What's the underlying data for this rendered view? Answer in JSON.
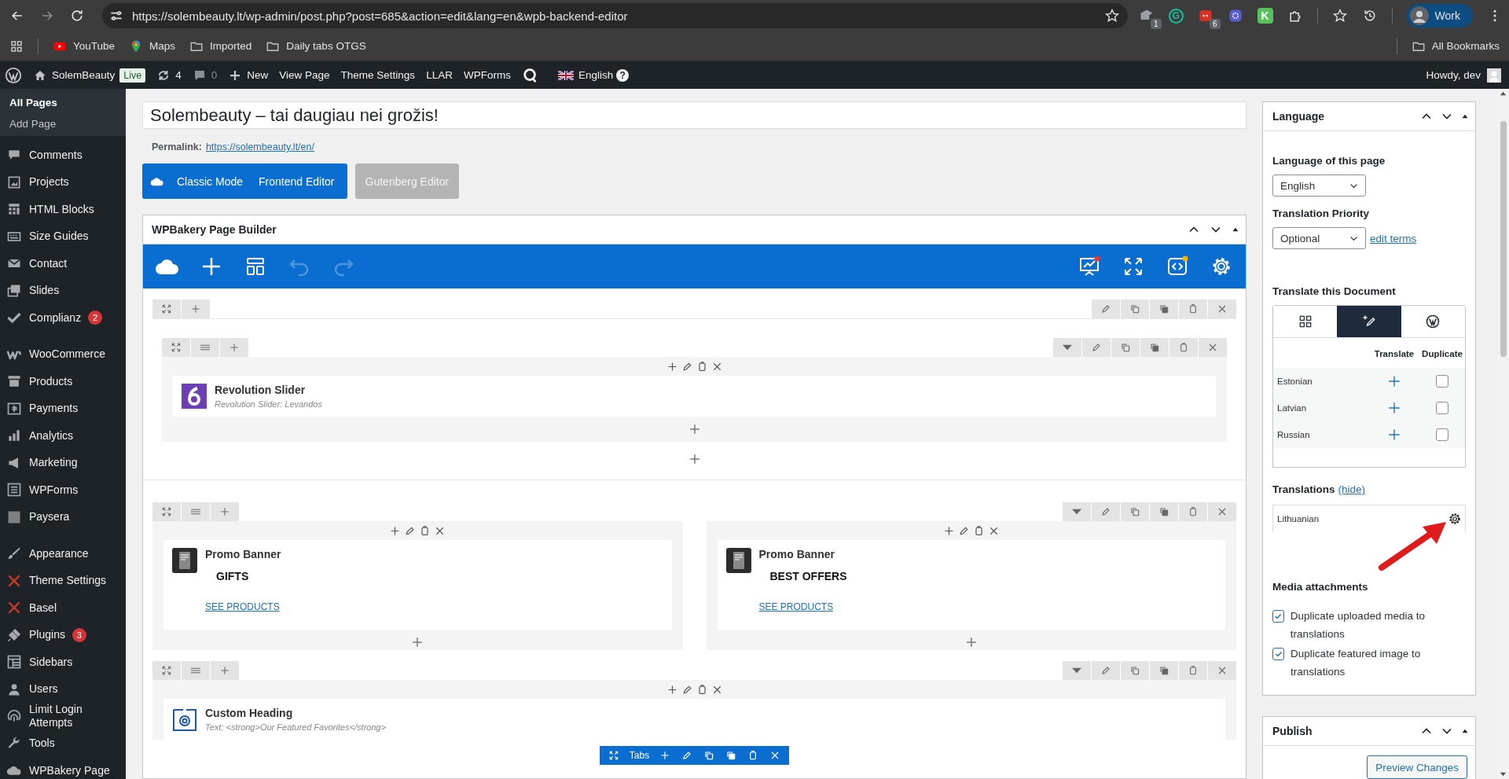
{
  "browser": {
    "url": "https://solembeauty.lt/wp-admin/post.php?post=685&action=edit&lang=en&wpb-backend-editor",
    "extensions": [
      {
        "kind": "grey",
        "badge": "1"
      },
      {
        "kind": "ring",
        "glyph": "G"
      },
      {
        "kind": "red",
        "badge": "6"
      },
      {
        "kind": "burst"
      },
      {
        "kind": "tile",
        "glyph": "K"
      }
    ],
    "profile": "Work",
    "bookmarks": [
      {
        "kind": "video",
        "label": "YouTube"
      },
      {
        "kind": "pin",
        "label": "Maps"
      },
      {
        "kind": "folder",
        "label": "Imported"
      },
      {
        "kind": "folder",
        "label": "Daily tabs OTGS"
      }
    ],
    "all_bookmarks": "All Bookmarks"
  },
  "admin_bar": {
    "site": "SolemBeauty",
    "live": "Live",
    "updates": "4",
    "comments": "0",
    "links": [
      "New",
      "View Page",
      "Theme Settings",
      "LLAR",
      "WPForms"
    ],
    "language": "English",
    "help": "?",
    "greeting": "Howdy, dev"
  },
  "sidebar": {
    "submenu": [
      {
        "label": "All Pages",
        "selected": true
      },
      {
        "label": "Add Page",
        "selected": false
      }
    ],
    "groups": [
      [
        {
          "label": "Comments"
        },
        {
          "label": "Projects"
        },
        {
          "label": "HTML Blocks"
        },
        {
          "label": "Size Guides"
        },
        {
          "label": "Contact"
        },
        {
          "label": "Slides"
        },
        {
          "label": "Complianz",
          "badge": "2"
        }
      ],
      [
        {
          "label": "WooCommerce"
        },
        {
          "label": "Products"
        },
        {
          "label": "Payments"
        },
        {
          "label": "Analytics"
        },
        {
          "label": "Marketing"
        },
        {
          "label": "WPForms"
        },
        {
          "label": "Paysera"
        }
      ],
      [
        {
          "label": "Appearance"
        },
        {
          "label": "Theme Settings"
        },
        {
          "label": "Basel"
        },
        {
          "label": "Plugins",
          "badge": "3"
        },
        {
          "label": "Sidebars"
        },
        {
          "label": "Users"
        },
        {
          "label": "Limit Login Attempts"
        },
        {
          "label": "Tools"
        },
        {
          "label": "WPBakery Page"
        }
      ]
    ]
  },
  "editor": {
    "title": "Solembeauty – tai daugiau nei grožis!",
    "permalink_label": "Permalink:",
    "permalink": "https://solembeauty.lt/en/",
    "modes": [
      "Classic Mode",
      "Frontend Editor"
    ],
    "gutenberg": "Gutenberg Editor"
  },
  "builder": {
    "title": "WPBakery Page Builder",
    "rows": [
      {
        "kind": "section",
        "columns": [
          [
            {
              "kind": "slider",
              "name": "Revolution Slider",
              "subtitle": "Revolution Slider: Levandos"
            }
          ]
        ]
      },
      {
        "kind": "row",
        "columns": [
          [
            {
              "kind": "banner",
              "name": "Promo Banner",
              "heading": "GIFTS",
              "link": "SEE PRODUCTS"
            }
          ],
          [
            {
              "kind": "banner",
              "name": "Promo Banner",
              "heading": "BEST OFFERS",
              "link": "SEE PRODUCTS"
            }
          ]
        ]
      },
      {
        "kind": "row",
        "columns": [
          [
            {
              "kind": "heading",
              "name": "Custom Heading",
              "subtitle": "Text: <strong>Our Featured Favorites</strong>"
            }
          ]
        ]
      }
    ],
    "floating_bar": "Tabs"
  },
  "language_box": {
    "title": "Language",
    "page_language_label": "Language of this page",
    "page_language": "English",
    "priority_label": "Translation Priority",
    "priority": "Optional",
    "edit_terms": "edit terms",
    "translate_label": "Translate this Document",
    "tabs": [
      {
        "kind": "grid",
        "selected": false
      },
      {
        "kind": "edit",
        "selected": true
      },
      {
        "kind": "wordpress",
        "selected": false
      }
    ],
    "columns": [
      "Translate",
      "Duplicate"
    ],
    "languages": [
      {
        "name": "Estonian",
        "duplicate": false
      },
      {
        "name": "Latvian",
        "duplicate": false
      },
      {
        "name": "Russian",
        "duplicate": false
      }
    ],
    "translations_label": "Translations",
    "hide": "(hide)",
    "translations": [
      "Lithuanian"
    ],
    "media_label": "Media attachments",
    "media_options": [
      {
        "label": "Duplicate uploaded media to translations",
        "checked": true
      },
      {
        "label": "Duplicate featured image to translations",
        "checked": true
      }
    ]
  },
  "publish_box": {
    "title": "Publish",
    "button": "Preview Changes"
  }
}
